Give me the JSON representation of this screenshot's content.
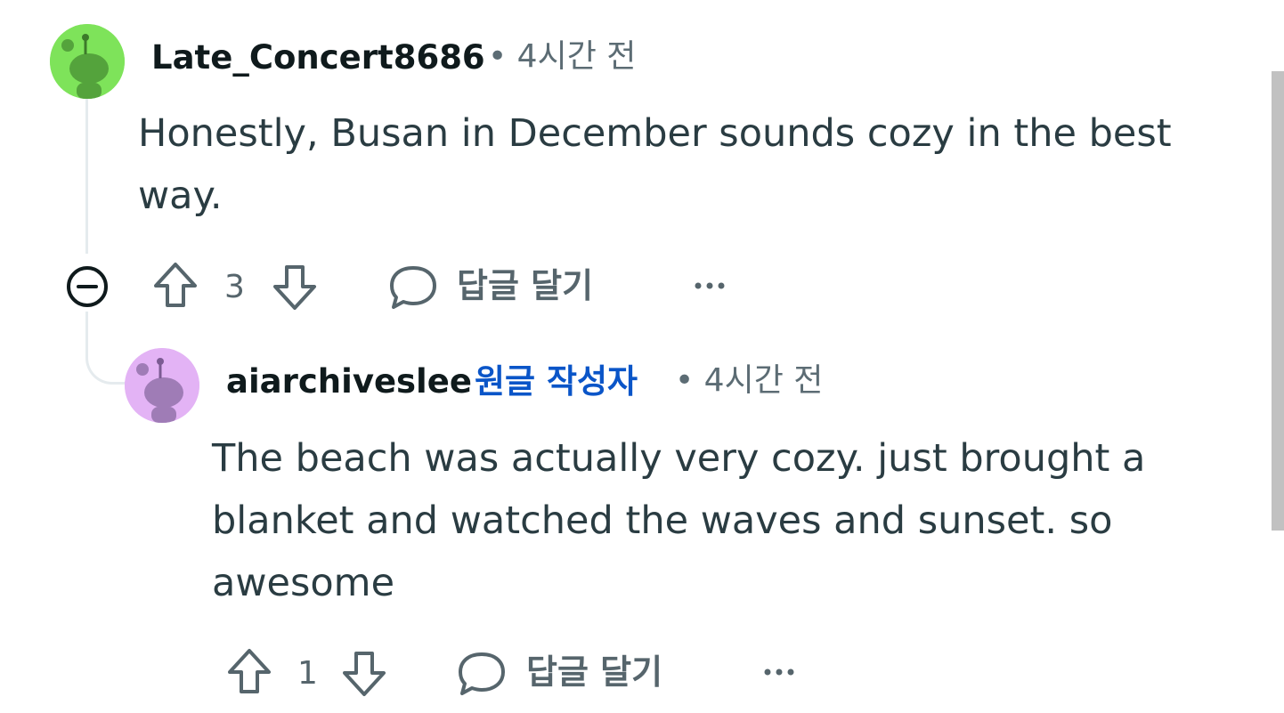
{
  "comments": [
    {
      "username": "Late_Concert8686",
      "time": "• 4시간 전",
      "body": "Honestly, Busan in December sounds cozy in the best way.",
      "votes": "3",
      "reply_label": "답글 달기",
      "avatar_color": "#7ee35a"
    },
    {
      "username": "aiarchiveslee",
      "op_badge": "원글 작성자",
      "time": "• 4시간 전",
      "body": "The beach was actually very cozy. just brought a blanket and watched the waves and sunset. so awesome",
      "votes": "1",
      "reply_label": "답글 달기",
      "avatar_color": "#e3b3f5"
    }
  ],
  "icons": {
    "collapse": "minus-circle-icon",
    "upvote": "arrow-up-icon",
    "downvote": "arrow-down-icon",
    "reply": "speech-bubble-icon",
    "more": "ellipsis-icon"
  }
}
